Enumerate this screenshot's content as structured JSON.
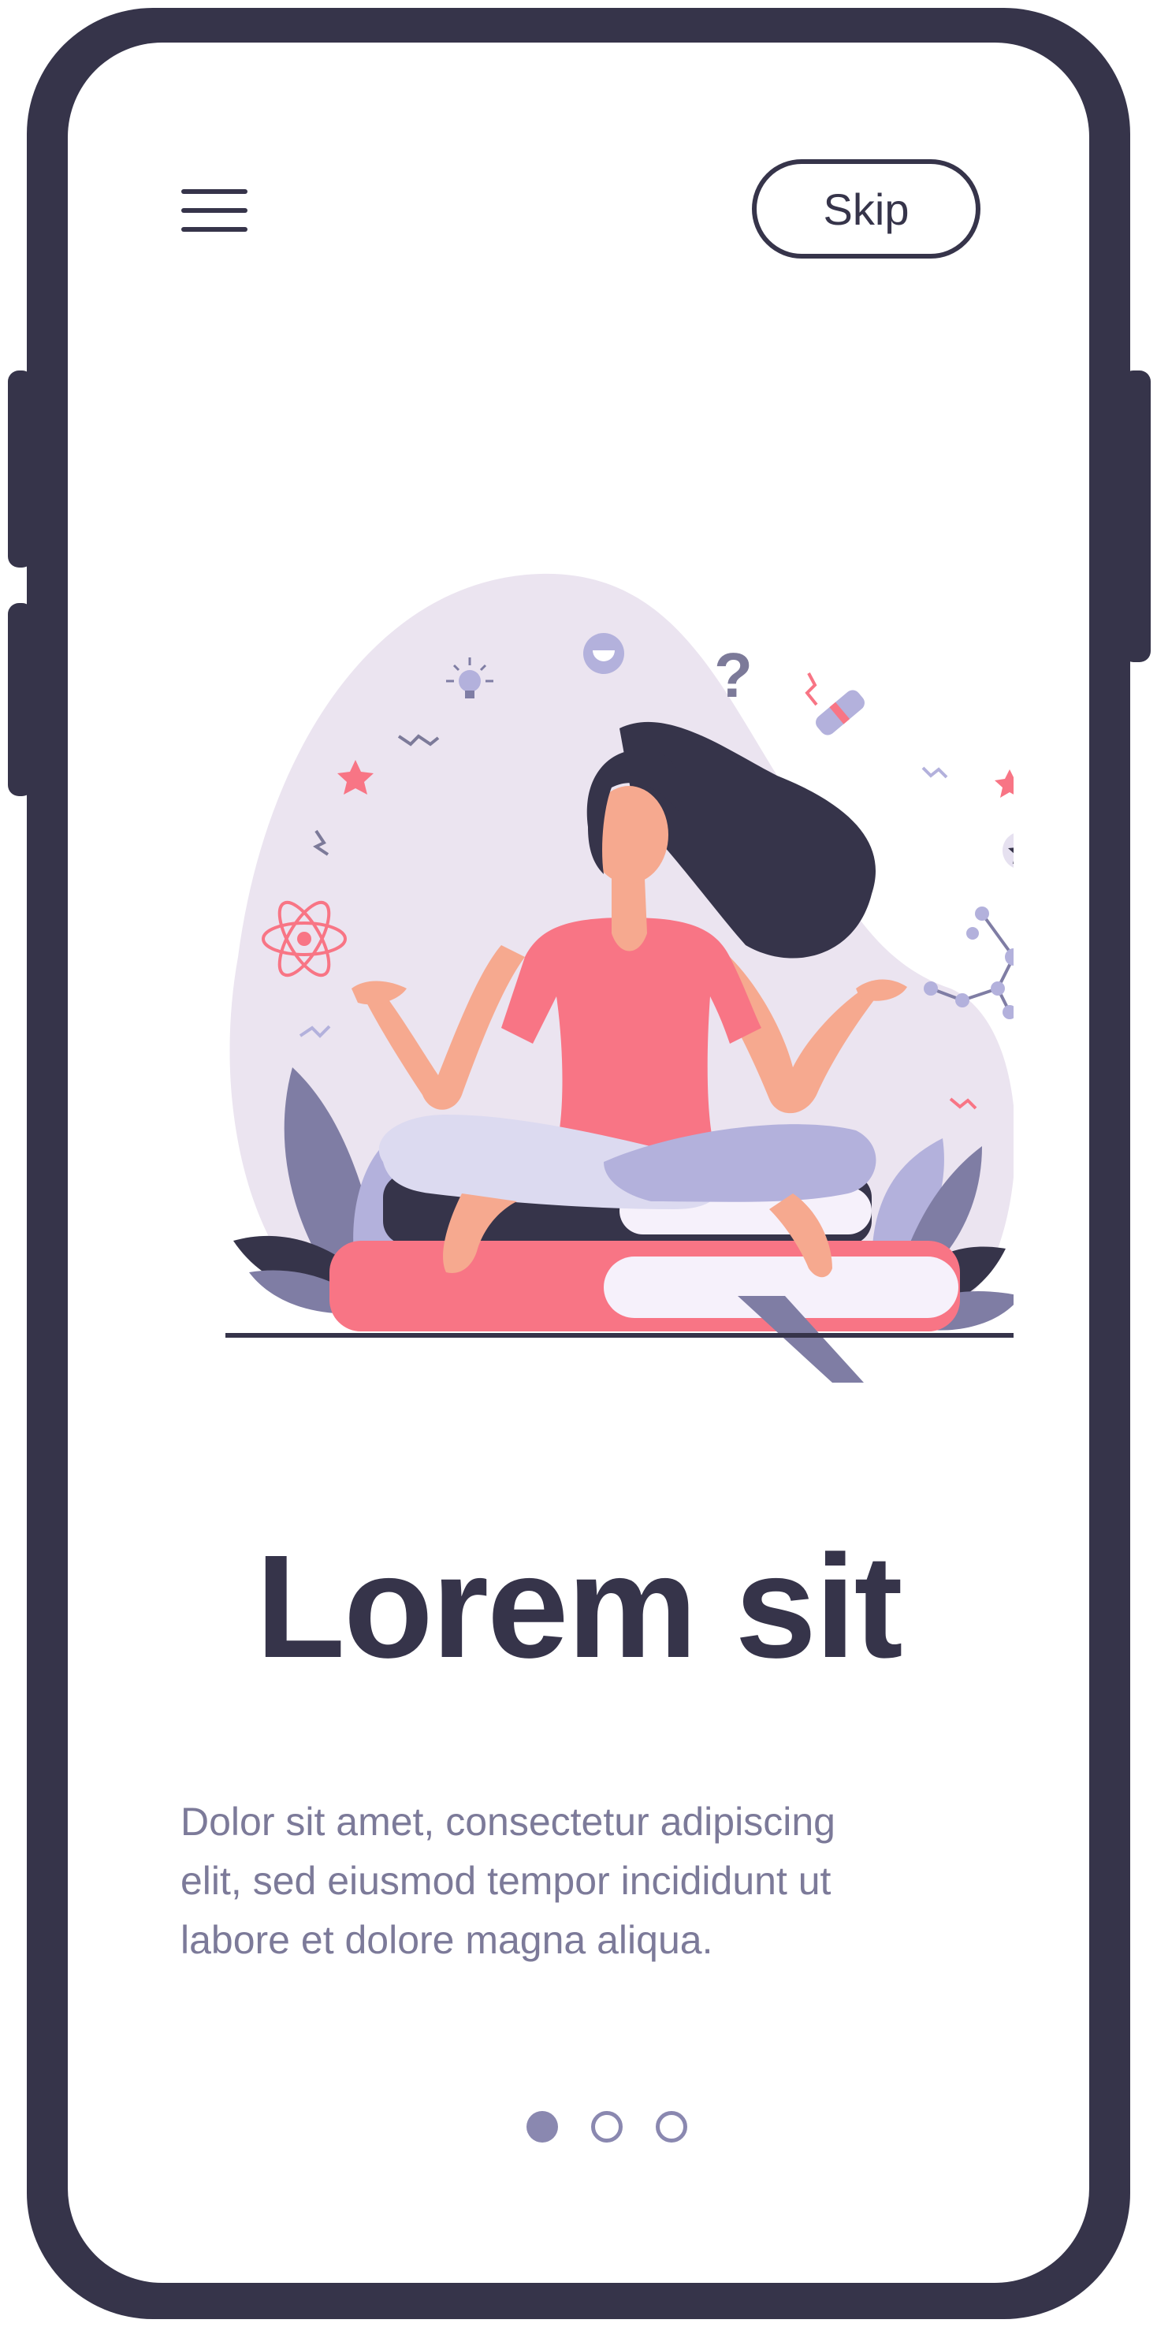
{
  "header": {
    "menu_icon": "hamburger-menu-icon",
    "skip_label": "Skip"
  },
  "illustration": {
    "subject": "meditation-illustration"
  },
  "onboarding": {
    "title": "Lorem sit",
    "body_lines": [
      "Dolor sit amet, consectetur adipiscing",
      "elit, sed eiusmod tempor incididunt ut",
      "labore et dolore magna aliqua."
    ]
  },
  "pager": {
    "total": 3,
    "current": 1
  },
  "colors": {
    "frame": "#36344a",
    "text_primary": "#36344a",
    "text_secondary": "#7c7a99",
    "accent_pink": "#f87585",
    "accent_lavender": "#b3b1dc",
    "blob": "#ebe4f0",
    "indicator": "#8a88b0"
  }
}
